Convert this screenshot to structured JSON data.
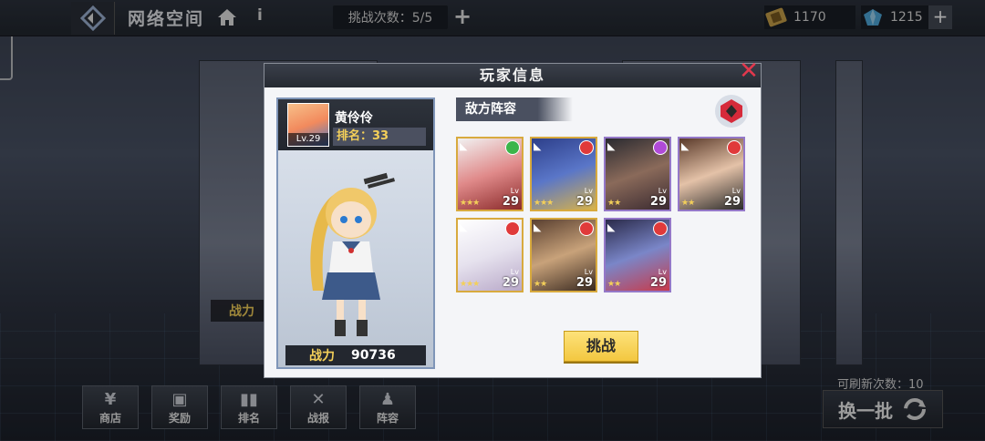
{
  "topbar": {
    "title": "网络空间",
    "challenge_count": "挑战次数：5/5",
    "currency_1": "1170",
    "currency_2": "1215"
  },
  "background": {
    "card_power_label": "战力"
  },
  "bottom_menu": [
    {
      "label": "商店",
      "icon": "shop-icon"
    },
    {
      "label": "奖励",
      "icon": "gift-icon"
    },
    {
      "label": "排名",
      "icon": "ranking-icon"
    },
    {
      "label": "战报",
      "icon": "battle-report-icon"
    },
    {
      "label": "阵容",
      "icon": "lineup-icon"
    }
  ],
  "refresh": {
    "count_text": "可刷新次数：10",
    "swap_label": "换一批"
  },
  "modal": {
    "title": "玩家信息",
    "player": {
      "name": "黄伶伶",
      "level": "Lv.29",
      "rank_text": "排名：33",
      "power_label": "战力",
      "power_value": "90736"
    },
    "enemy_title": "敌方阵容",
    "heroes": [
      {
        "frame": "gold",
        "element_color": "#3bb54a",
        "stars": "★★★",
        "level": "29"
      },
      {
        "frame": "gold",
        "element_color": "#e03a3a",
        "stars": "★★★",
        "level": "29"
      },
      {
        "frame": "purple",
        "element_color": "#b04ad8",
        "stars": "★★",
        "level": "29"
      },
      {
        "frame": "purple",
        "element_color": "#e03a3a",
        "stars": "★★",
        "level": "29"
      },
      {
        "frame": "gold",
        "element_color": "#e03a3a",
        "stars": "★★★",
        "level": "29"
      },
      {
        "frame": "gold",
        "element_color": "#e03a3a",
        "stars": "★★",
        "level": "29"
      },
      {
        "frame": "purple",
        "element_color": "#e03a3a",
        "stars": "★★",
        "level": "29"
      }
    ],
    "hero_lv_label": "Lv",
    "challenge_label": "挑战"
  }
}
